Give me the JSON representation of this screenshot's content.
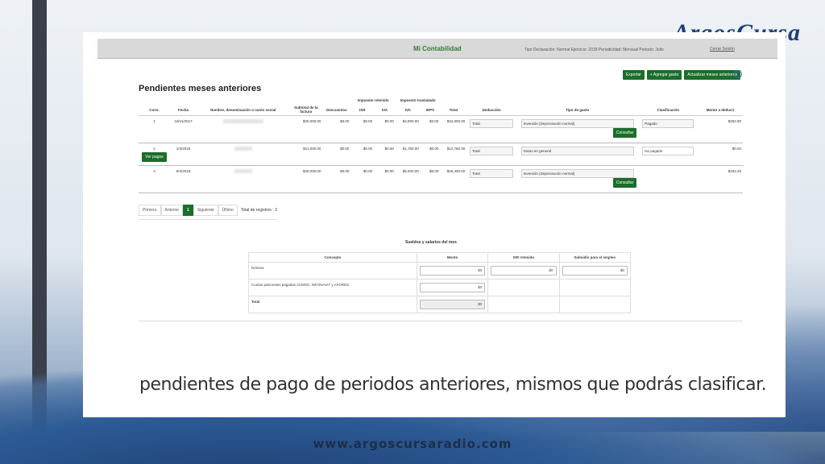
{
  "brand": {
    "name": "ArgosCursa"
  },
  "footer": {
    "website": "www.argoscursaradio.com"
  },
  "appbar": {
    "title": "Mi Contabilidad",
    "meta": "Tipo Declaración: Normal Ejercicio: 2018 Periodicidad: Mensual Periodo: Julio",
    "logout": "Cerrar Sesión"
  },
  "actions": {
    "export": "Exportar",
    "add_expense": "+ Agregar gasto",
    "update_prev": "Actualizar meses anteriores",
    "help": "?"
  },
  "section_title": "Pendientes meses anteriores",
  "table": {
    "group_headers": {
      "retenido": "Impuesto retenido",
      "trasladado": "Impuesto trasladado"
    },
    "columns": [
      "Cons.",
      "Fecha",
      "Nombre, denominación o razón social",
      "Subtotal de la factura",
      "Descuentos",
      "ISR",
      "IVA",
      "IVA",
      "IEPS",
      "Total",
      "Deducción",
      "Tipo de gasto",
      "Clasificación",
      "Monto a deducir"
    ],
    "rows": [
      {
        "cons": "1",
        "fecha": "19/11/2017",
        "subtotal": "$30,000.00",
        "descuentos": "$0.00",
        "isr": "$0.00",
        "iva_ret": "$0.00",
        "iva_tras": "$4,800.00",
        "ieps": "$0.00",
        "total": "$34,800.00",
        "deduccion": "Total",
        "tipo": "Inversión (Depreciación normal)",
        "clasificacion": "Pagado",
        "monto": "$252.80",
        "action": "Consultar"
      },
      {
        "cons": "2",
        "fecha": "1/3/2018",
        "subtotal": "$11,000.00",
        "descuentos": "$0.00",
        "isr": "$0.00",
        "iva_ret": "$0.00",
        "iva_tras": "$1,760.00",
        "ieps": "$0.00",
        "total": "$12,760.00",
        "deduccion": "Total",
        "tipo": "Gasto en general",
        "clasificacion": "No pagado",
        "monto": "$0.00",
        "extra_button": "Ver pagos"
      },
      {
        "cons": "3",
        "fecha": "9/3/2018",
        "subtotal": "$40,000.00",
        "descuentos": "$0.00",
        "isr": "$0.00",
        "iva_ret": "$0.00",
        "iva_tras": "$6,400.00",
        "ieps": "$0.00",
        "total": "$46,400.00",
        "deduccion": "Total",
        "tipo": "Inversión (Depreciación normal)",
        "clasificacion": "",
        "monto": "$333.33",
        "action": "Consultar"
      }
    ]
  },
  "pager": {
    "first": "Primero",
    "prev": "Anterior",
    "current": "1",
    "next": "Siguiente",
    "last": "Último",
    "total": "Total de registros : 3"
  },
  "salaries": {
    "title": "Sueldos y salarios del mes",
    "columns": [
      "Concepto",
      "Monto",
      "ISR retenido",
      "Subsidio para el empleo"
    ],
    "rows": [
      {
        "concepto": "Nómina",
        "monto": "$0",
        "isr": "$0",
        "subsidio": "$0"
      },
      {
        "concepto": "Cuotas patronales pagadas al IMSS, INFONAVIT y AFORES",
        "monto": "$0"
      },
      {
        "concepto": "Total",
        "monto": "$0"
      }
    ]
  },
  "caption": "pendientes de pago de periodos anteriores, mismos que podrás clasificar."
}
